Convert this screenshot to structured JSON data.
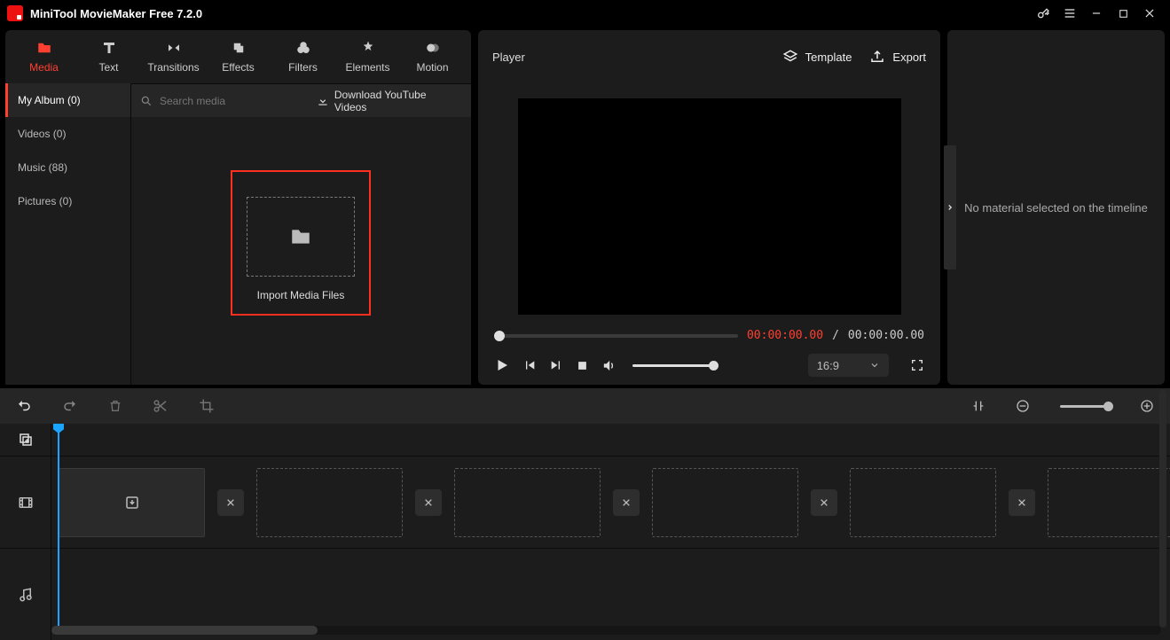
{
  "window": {
    "title": "MiniTool MovieMaker Free 7.2.0"
  },
  "tabs": {
    "media": "Media",
    "text": "Text",
    "transitions": "Transitions",
    "effects": "Effects",
    "filters": "Filters",
    "elements": "Elements",
    "motion": "Motion"
  },
  "sidebar": {
    "items": [
      {
        "label": "My Album (0)"
      },
      {
        "label": "Videos (0)"
      },
      {
        "label": "Music (88)"
      },
      {
        "label": "Pictures (0)"
      }
    ]
  },
  "search": {
    "placeholder": "Search media"
  },
  "download_yt": "Download YouTube Videos",
  "import_label": "Import Media Files",
  "player": {
    "title": "Player",
    "template": "Template",
    "export": "Export",
    "time_current": "00:00:00.00",
    "time_sep": "/",
    "time_total": "00:00:00.00",
    "aspect": "16:9"
  },
  "right_hint": "No material selected on the timeline"
}
